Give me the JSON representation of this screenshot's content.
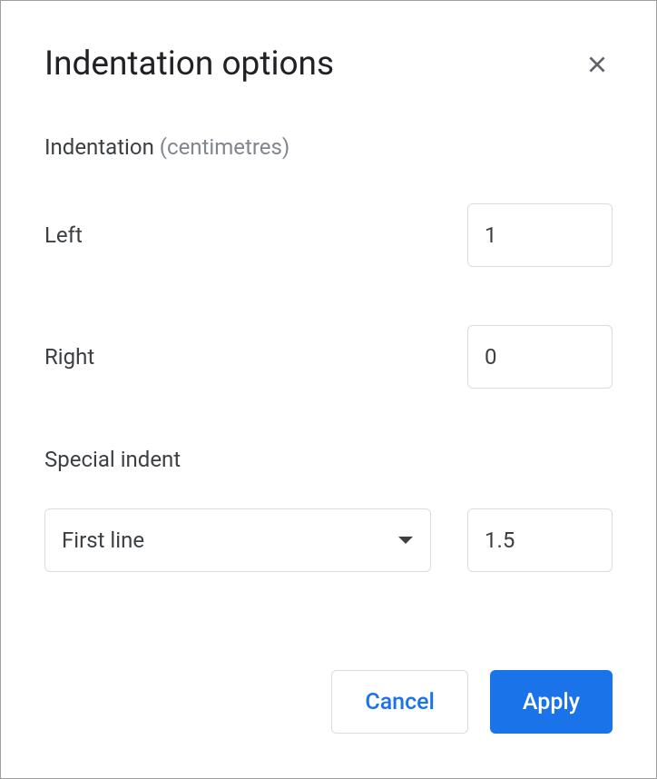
{
  "dialog": {
    "title": "Indentation options",
    "section_label": "Indentation",
    "section_unit": "(centimetres)",
    "left": {
      "label": "Left",
      "value": "1"
    },
    "right": {
      "label": "Right",
      "value": "0"
    },
    "special": {
      "label": "Special indent",
      "selected": "First line",
      "value": "1.5"
    },
    "buttons": {
      "cancel": "Cancel",
      "apply": "Apply"
    }
  }
}
